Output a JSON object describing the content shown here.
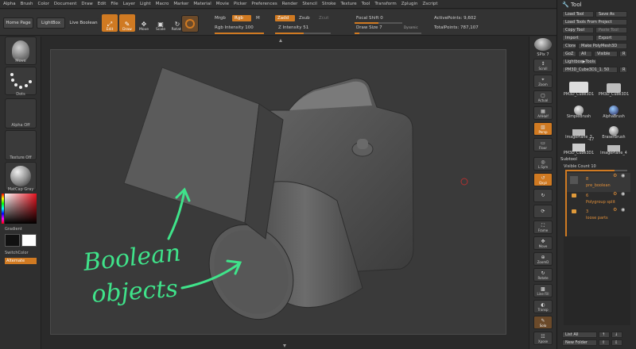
{
  "menu": [
    "Alpha",
    "Brush",
    "Color",
    "Document",
    "Draw",
    "Edit",
    "File",
    "Layer",
    "Light",
    "Macro",
    "Marker",
    "Material",
    "Movie",
    "Picker",
    "Preferences",
    "Render",
    "Stencil",
    "Stroke",
    "Texture",
    "Tool",
    "Transform",
    "Zplugin",
    "Zscript"
  ],
  "toolbar": {
    "home_page": "Home Page",
    "lightbox": "LightBox",
    "live_boolean": "Live Boolean",
    "tools": [
      "Edit",
      "Draw",
      "Move",
      "Scale",
      "Rotate"
    ],
    "mrgb": "Mrgb",
    "rgb": "Rgb",
    "m": "M",
    "zadd": "Zadd",
    "zsub": "Zsub",
    "zcut": "Zcut",
    "rgb_intensity": "Rgb Intensity 100",
    "z_intensity": "Z Intensity 51",
    "focal_shift": "Focal Shift 0",
    "draw_size": "Draw Size 7",
    "dynamic": "Dynamic",
    "active_points": "ActivePoints: 9,602",
    "total_points": "TotalPoints: 787,107"
  },
  "left_shelf": {
    "move": "Move",
    "dots": "Dots",
    "alpha_off": "Alpha Off",
    "texture_off": "Texture Off",
    "matcap_gray": "MatCap Gray",
    "gradient": "Gradient",
    "switch_color": "SwitchColor",
    "alternate": "Alternate"
  },
  "right_shelf": {
    "spix": "SPix 7",
    "buttons": [
      "Scroll",
      "Zoom",
      "Actual",
      "AAHalf",
      "Persp",
      "Floor",
      "L.Sym",
      "Qxyz",
      "",
      "",
      "Frame",
      "Move",
      "ZoomD",
      "Rotate",
      "Line Fill",
      "PolyF",
      "Transp",
      "Ghost",
      "Solo",
      "Xpose"
    ]
  },
  "palette": {
    "title": "Tool",
    "load_tool": "Load Tool",
    "save_as": "Save As",
    "load_tools_from_project": "Load Tools From Project",
    "copy_tool": "Copy Tool",
    "paste_tool": "Paste Tool",
    "import": "Import",
    "export": "Export",
    "clone": "Clone",
    "make_polymesh": "Make PolyMesh3D",
    "goz": "GoZ",
    "all": "All",
    "visible": "Visible",
    "r": "R",
    "lightbox_tools": "Lightbox▶Tools",
    "current_tool": "PM3D_Cube3D1_1. 50",
    "r2": "R",
    "brushes": [
      {
        "name": "PM3D_Cube3D1",
        "badge": ""
      },
      {
        "name": "PM3D_Cube3D1",
        "badge": ""
      },
      {
        "name": "SimpleBrush",
        "badge": ""
      },
      {
        "name": "AlphaBrush",
        "badge": ""
      },
      {
        "name": "ImagePlane_3",
        "badge": ""
      },
      {
        "name": "EraserBrush",
        "badge": ""
      },
      {
        "name": "PM3D_Cube3D1",
        "badge": "17"
      },
      {
        "name": "ImagePlane_4",
        "badge": ""
      }
    ],
    "subtool_title": "Subtool",
    "visible_count": "Visible Count 10",
    "subtools": [
      {
        "num": "8",
        "name": "pre_boolean"
      },
      {
        "num": "6",
        "name": "Polygroup split"
      },
      {
        "num": "3",
        "name": "loose parts"
      }
    ],
    "list_all": "List All",
    "new_folder": "New Folder"
  },
  "annotation": {
    "line1": "Boolean",
    "line2": "objects",
    "color": "#3fe38a"
  },
  "colors": {
    "accent": "#d07a22",
    "panel": "#2c2c2c"
  }
}
